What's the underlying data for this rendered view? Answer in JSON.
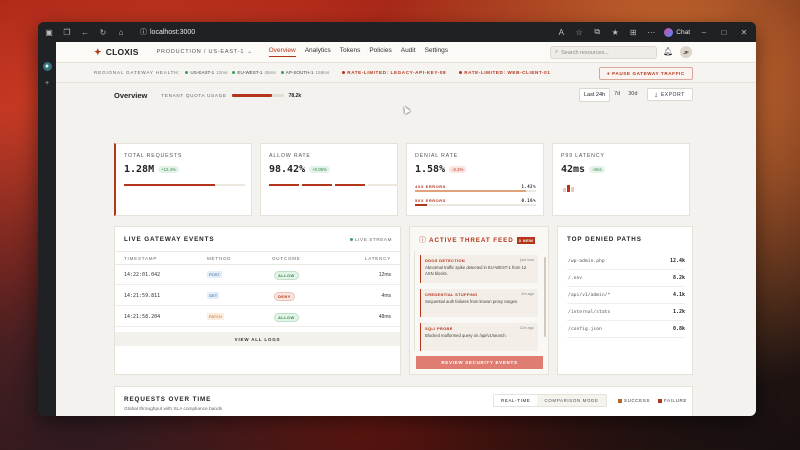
{
  "browser": {
    "url": "localhost:3000",
    "chat_label": "Chat"
  },
  "app": {
    "name": "CLOXIS",
    "environment": "PRODUCTION / US-EAST-1",
    "nav": [
      "Overview",
      "Analytics",
      "Tokens",
      "Policies",
      "Audit",
      "Settings"
    ],
    "active_nav": "Overview",
    "search_placeholder": "Search resources...",
    "avatar_initials": "JF"
  },
  "health": {
    "title": "REGIONAL GATEWAY HEALTH:",
    "regions": [
      {
        "name": "US-EAST-1",
        "latency": "12ms"
      },
      {
        "name": "EU-WEST-1",
        "latency": "45ms"
      },
      {
        "name": "AP-SOUTH-1",
        "latency": "158ms"
      }
    ],
    "alerts": [
      "RATE-LIMITED: LEGACY-API-KEY-08",
      "RATE-LIMITED: WEB-CLIENT-01"
    ],
    "pause_button": "PAUSE GATEWAY TRAFFIC"
  },
  "overview": {
    "title": "Overview",
    "quota_label": "TENANT QUOTA USAGE",
    "quota_value": "78.2k",
    "quota_fraction": 0.78,
    "ranges": [
      "Last 24h",
      "7d",
      "30d"
    ],
    "active_range": "Last 24h",
    "export_label": "EXPORT"
  },
  "kpis": {
    "total_requests": {
      "label": "TOTAL REQUESTS",
      "value": "1.28M",
      "delta": "+12.4%",
      "fraction": 0.75
    },
    "allow_rate": {
      "label": "ALLOW RATE",
      "value": "98.42%",
      "delta": "+0.05%"
    },
    "denial_rate": {
      "label": "DENIAL RATE",
      "value": "1.58%",
      "delta": "-2.1%",
      "errors": [
        {
          "label": "4XX ERRORS",
          "value": "1.42%",
          "fraction": 0.92,
          "color": "#e0a27a"
        },
        {
          "label": "5XX ERRORS",
          "value": "0.16%",
          "fraction": 0.1,
          "color": "#b3361b"
        }
      ]
    },
    "p99_latency": {
      "label": "P99 LATENCY",
      "value": "42ms",
      "delta": "-4ms"
    }
  },
  "live_events": {
    "title": "LIVE GATEWAY EVENTS",
    "stream_label": "LIVE STREAM",
    "columns": [
      "TIMESTAMP",
      "METHOD",
      "OUTCOME",
      "LATENCY"
    ],
    "rows": [
      {
        "timestamp": "14:22:01.042",
        "method": "POST",
        "outcome": "ALLOW",
        "latency": "12ms"
      },
      {
        "timestamp": "14:21:59.811",
        "method": "GET",
        "outcome": "DENY",
        "latency": "4ms"
      },
      {
        "timestamp": "14:21:58.204",
        "method": "PATCH",
        "outcome": "ALLOW",
        "latency": "48ms"
      }
    ],
    "view_all": "VIEW ALL LOGS"
  },
  "threat_feed": {
    "title": "ACTIVE THREAT FEED",
    "badge": "3 NEW",
    "items": [
      {
        "title": "DDOS DETECTION",
        "time": "just now",
        "desc": "Abnormal traffic spike detected in EU-WEST-1 from 12 ASN blocks."
      },
      {
        "title": "CREDENTIAL STUFFING",
        "time": "4m ago",
        "desc": "Sequential auth failures from known proxy ranges."
      },
      {
        "title": "SQLI PROBE",
        "time": "12m ago",
        "desc": "Blocked malformed query on /api/v1/search."
      }
    ],
    "review_button": "REVIEW SECURITY EVENTS"
  },
  "denied_paths": {
    "title": "TOP DENIED PATHS",
    "rows": [
      {
        "path": "/wp-admin.php",
        "count": "12.4k"
      },
      {
        "path": "/.env",
        "count": "8.2k"
      },
      {
        "path": "/api/v1/admin/*",
        "count": "4.1k"
      },
      {
        "path": "/internal/stats",
        "count": "1.2k"
      },
      {
        "path": "/config.json",
        "count": "0.8k"
      }
    ]
  },
  "requests_over_time": {
    "title": "REQUESTS OVER TIME",
    "subtitle": "Global throughput with SLA compliance bands",
    "tabs": [
      "REAL-TIME",
      "COMPARISON MODE"
    ],
    "active_tab": "REAL-TIME",
    "legend": [
      "SUCCESS",
      "FAILURE"
    ]
  }
}
